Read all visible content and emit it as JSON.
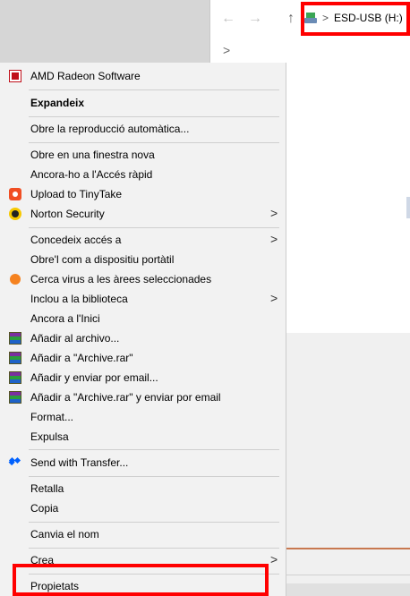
{
  "explorer": {
    "back_icon": "back-arrow-icon",
    "forward_icon": "forward-arrow-icon",
    "up_icon": "up-arrow-icon",
    "address_separator": ">",
    "address_drive": "ESD-USB (H:)",
    "sub_chevron": ">"
  },
  "menu": {
    "items": [
      {
        "label": "AMD Radeon Software",
        "icon": "amd-icon"
      },
      {
        "label": "Expandeix"
      },
      {
        "label": "Obre la reproducció automàtica..."
      },
      {
        "label": "Obre en una finestra nova"
      },
      {
        "label": "Ancora-ho a l'Accés ràpid"
      },
      {
        "label": "Upload to TinyTake",
        "icon": "tinytake-icon"
      },
      {
        "label": "Norton Security",
        "icon": "norton-icon",
        "submenu": ">"
      },
      {
        "label": "Concedeix accés a",
        "submenu": ">"
      },
      {
        "label": "Obre'l com a dispositiu portàtil"
      },
      {
        "label": "Cerca virus a les àrees seleccionades",
        "icon": "avast-icon"
      },
      {
        "label": "Inclou a la biblioteca",
        "submenu": ">"
      },
      {
        "label": "Ancora a l'Inici"
      },
      {
        "label": "Añadir al archivo...",
        "icon": "winrar-icon"
      },
      {
        "label": "Añadir a \"Archive.rar\"",
        "icon": "winrar-icon"
      },
      {
        "label": "Añadir y enviar por email...",
        "icon": "winrar-icon"
      },
      {
        "label": "Añadir a \"Archive.rar\" y enviar por email",
        "icon": "winrar-icon"
      },
      {
        "label": "Format..."
      },
      {
        "label": "Expulsa"
      },
      {
        "label": "Send with Transfer...",
        "icon": "dropbox-icon"
      },
      {
        "label": "Retalla"
      },
      {
        "label": "Copia"
      },
      {
        "label": "Canvia el nom"
      },
      {
        "label": "Crea",
        "submenu": ">"
      },
      {
        "label": "Propietats"
      }
    ]
  },
  "colors": {
    "highlight": "#ff0000",
    "menu_background": "#f2f2f2"
  }
}
